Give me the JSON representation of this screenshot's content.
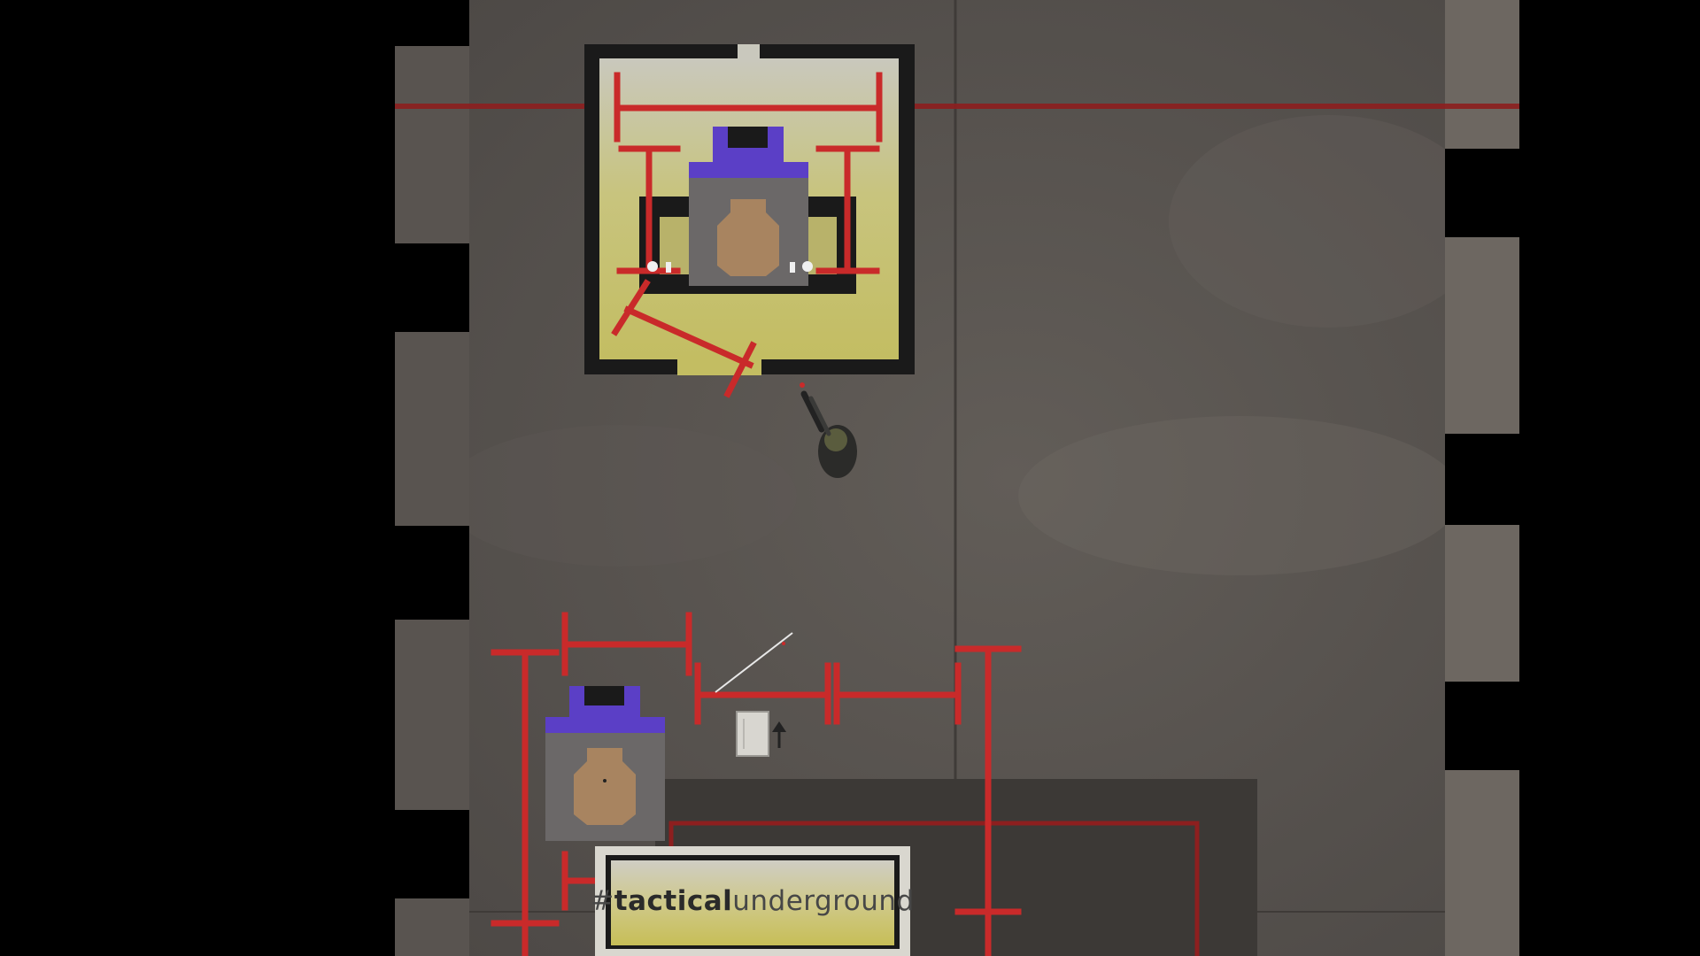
{
  "game": {
    "view": "top-down tactical room",
    "watermark": {
      "hash": "#",
      "bold": "tactical",
      "light": "underground"
    }
  },
  "colors": {
    "floor": "#5a5551",
    "floor_dark": "#4a4643",
    "wall": "#111111",
    "barrier_red": "#c92a2a",
    "laser_red": "#8d1f1f",
    "target_blue": "#5b3fc6",
    "target_tan": "#a88460",
    "target_board": "#6b6868",
    "mat_yellow": "#c9c36e",
    "mat_light": "#c8c6b9"
  },
  "icons": {
    "player": "operator-icon",
    "door": "door-icon",
    "arrow": "arrow-up-icon"
  }
}
